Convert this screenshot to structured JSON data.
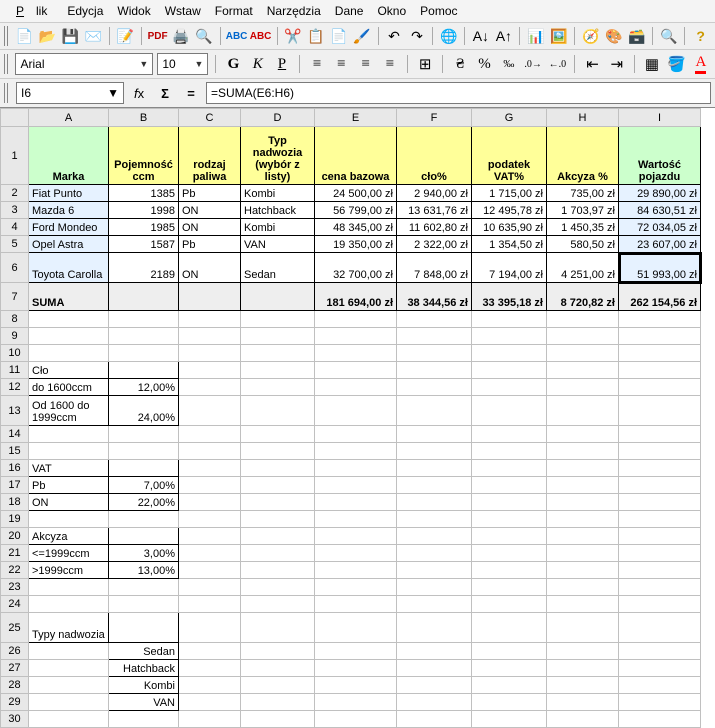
{
  "menu": {
    "file": "Plik",
    "edit": "Edycja",
    "view": "Widok",
    "insert": "Wstaw",
    "format": "Format",
    "tools": "Narzędzia",
    "data": "Dane",
    "window": "Okno",
    "help": "Pomoc"
  },
  "font": {
    "name": "Arial",
    "size": "10"
  },
  "namebox": "I6",
  "formula": "=SUMA(E6:H6)",
  "cols": [
    "A",
    "B",
    "C",
    "D",
    "E",
    "F",
    "G",
    "H",
    "I"
  ],
  "headers": {
    "A": "Marka",
    "B": "Pojemność ccm",
    "C": "rodzaj paliwa",
    "D": "Typ nadwozia (wybór z listy)",
    "E": "cena bazowa",
    "F": "cło%",
    "G": "podatek VAT%",
    "H": "Akcyza %",
    "I": "Wartość pojazdu"
  },
  "rows": [
    {
      "r": "2",
      "A": "Fiat Punto",
      "B": "1385",
      "C": "Pb",
      "D": "Kombi",
      "E": "24 500,00 zł",
      "F": "2 940,00 zł",
      "G": "1 715,00 zł",
      "H": "735,00 zł",
      "I": "29 890,00 zł"
    },
    {
      "r": "3",
      "A": "Mazda 6",
      "B": "1998",
      "C": "ON",
      "D": "Hatchback",
      "E": "56 799,00 zł",
      "F": "13 631,76 zł",
      "G": "12 495,78 zł",
      "H": "1 703,97 zł",
      "I": "84 630,51 zł"
    },
    {
      "r": "4",
      "A": "Ford Mondeo",
      "B": "1985",
      "C": "ON",
      "D": "Kombi",
      "E": "48 345,00 zł",
      "F": "11 602,80 zł",
      "G": "10 635,90 zł",
      "H": "1 450,35 zł",
      "I": "72 034,05 zł"
    },
    {
      "r": "5",
      "A": "Opel Astra",
      "B": "1587",
      "C": "Pb",
      "D": "VAN",
      "E": "19 350,00 zł",
      "F": "2 322,00 zł",
      "G": "1 354,50 zł",
      "H": "580,50 zł",
      "I": "23 607,00 zł"
    },
    {
      "r": "6",
      "A": "Toyota Carolla",
      "B": "2189",
      "C": "ON",
      "D": "Sedan",
      "E": "32 700,00 zł",
      "F": "7 848,00 zł",
      "G": "7 194,00 zł",
      "H": "4 251,00 zł",
      "I": "51 993,00 zł"
    }
  ],
  "sum": {
    "label": "SUMA",
    "E": "181 694,00 zł",
    "F": "38 344,56 zł",
    "G": "33 395,18 zł",
    "H": "8 720,82 zł",
    "I": "262 154,56 zł"
  },
  "tables": {
    "t11A": "Cło",
    "t12A": "do 1600ccm",
    "t12B": "12,00%",
    "t13A": "Od 1600 do 1999ccm",
    "t13B": "24,00%",
    "t16A": "VAT",
    "t17A": "Pb",
    "t17B": "7,00%",
    "t18A": "ON",
    "t18B": "22,00%",
    "t20A": "Akcyza",
    "t21A": "<=1999ccm",
    "t21B": "3,00%",
    "t22A": ">1999ccm",
    "t22B": "13,00%",
    "t25A": "Typy nadwozia",
    "t26B": "Sedan",
    "t27B": "Hatchback",
    "t28B": "Kombi",
    "t29B": "VAN"
  },
  "chart_data": {
    "type": "table",
    "title": "Wartość pojazdu",
    "columns": [
      "Marka",
      "Pojemność ccm",
      "rodzaj paliwa",
      "Typ nadwozia",
      "cena bazowa",
      "cło%",
      "podatek VAT%",
      "Akcyza %",
      "Wartość pojazdu"
    ],
    "rows": [
      [
        "Fiat Punto",
        1385,
        "Pb",
        "Kombi",
        24500.0,
        2940.0,
        1715.0,
        735.0,
        29890.0
      ],
      [
        "Mazda 6",
        1998,
        "ON",
        "Hatchback",
        56799.0,
        13631.76,
        12495.78,
        1703.97,
        84630.51
      ],
      [
        "Ford Mondeo",
        1985,
        "ON",
        "Kombi",
        48345.0,
        11602.8,
        10635.9,
        1450.35,
        72034.05
      ],
      [
        "Opel Astra",
        1587,
        "Pb",
        "VAN",
        19350.0,
        2322.0,
        1354.5,
        580.5,
        23607.0
      ],
      [
        "Toyota Carolla",
        2189,
        "ON",
        "Sedan",
        32700.0,
        7848.0,
        7194.0,
        4251.0,
        51993.0
      ]
    ],
    "totals": {
      "cena bazowa": 181694.0,
      "cło%": 38344.56,
      "podatek VAT%": 33395.18,
      "Akcyza %": 8720.82,
      "Wartość pojazdu": 262154.56
    },
    "lookup_tables": {
      "Cło": {
        "do 1600ccm": 0.12,
        "Od 1600 do 1999ccm": 0.24
      },
      "VAT": {
        "Pb": 0.07,
        "ON": 0.22
      },
      "Akcyza": {
        "<=1999ccm": 0.03,
        ">1999ccm": 0.13
      },
      "Typy nadwozia": [
        "Sedan",
        "Hatchback",
        "Kombi",
        "VAN"
      ]
    }
  }
}
